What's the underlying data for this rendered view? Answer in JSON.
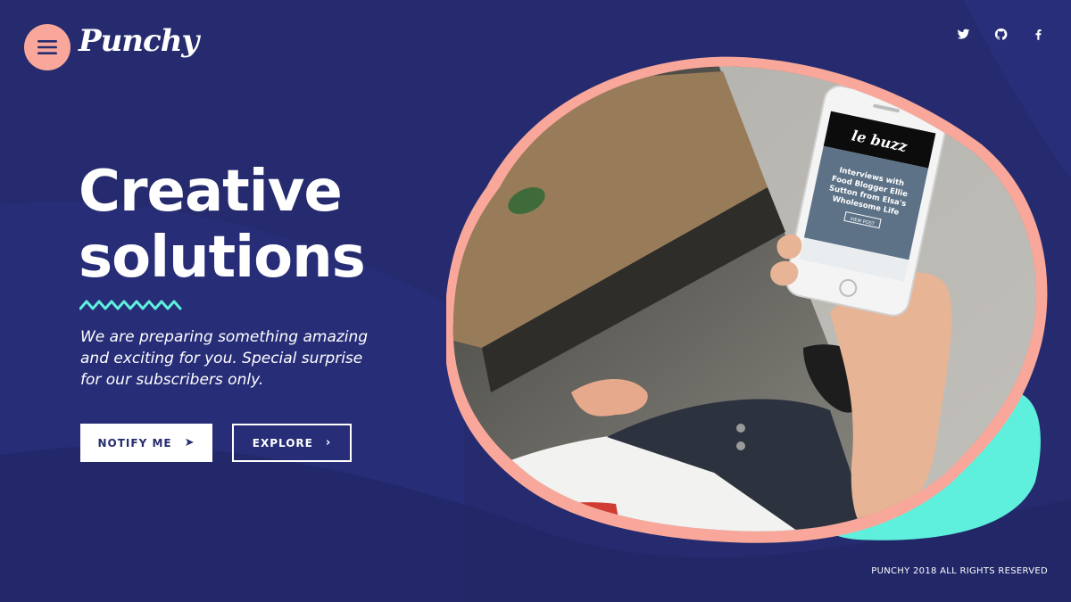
{
  "brand": {
    "logo_text": "Punchy"
  },
  "header": {
    "menu_icon": "hamburger-icon",
    "social": [
      {
        "name": "twitter",
        "icon": "twitter-icon"
      },
      {
        "name": "github",
        "icon": "github-icon"
      },
      {
        "name": "facebook",
        "icon": "facebook-icon"
      }
    ]
  },
  "hero": {
    "title_line1": "Creative",
    "title_line2": "solutions",
    "subtitle_line1": "We are preparing something amazing",
    "subtitle_line2": "and exciting for you. Special surprise",
    "subtitle_line3": "for our subscribers only."
  },
  "buttons": {
    "notify_label": "NOTIFY ME",
    "notify_icon": "arrow-right-icon",
    "explore_label": "EXPLORE",
    "explore_icon": "chevron-right-icon"
  },
  "phone_screen": {
    "app_logo": "le buzz",
    "headline_line1": "Interviews with",
    "headline_line2": "Food Blogger Ellie",
    "headline_line3": "Sutton from Elsa's",
    "headline_line4": "Wholesome Life",
    "cta": "VIEW POST"
  },
  "footer": {
    "copyright": "PUNCHY 2018 ALL RIGHTS RESERVED"
  },
  "colors": {
    "background": "#252b6e",
    "accent_peach": "#f9a79a",
    "accent_teal": "#5ef0dc",
    "text": "#ffffff"
  }
}
